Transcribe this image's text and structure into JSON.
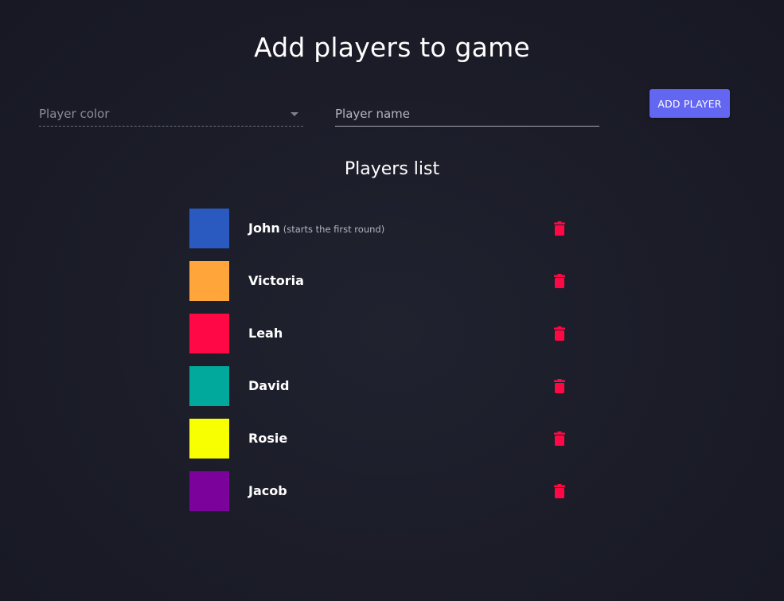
{
  "header": {
    "title": "Add players to game"
  },
  "form": {
    "color_label": "Player color",
    "name_label": "Player name",
    "add_button_label": "ADD PLAYER"
  },
  "players_section": {
    "title": "Players list",
    "players": [
      {
        "name": "John",
        "note": "(starts the first round)",
        "color": "#2a5ac0"
      },
      {
        "name": "Victoria",
        "note": "",
        "color": "#ffa53a"
      },
      {
        "name": "Leah",
        "note": "",
        "color": "#ff0845"
      },
      {
        "name": "David",
        "note": "",
        "color": "#00a99c"
      },
      {
        "name": "Rosie",
        "note": "",
        "color": "#f7ff00"
      },
      {
        "name": "Jacob",
        "note": "",
        "color": "#7b029b"
      }
    ]
  },
  "colors": {
    "accent": "#6366f1",
    "danger": "#ff0845"
  },
  "icons": {
    "delete": "trash-icon",
    "dropdown": "chevron-down-icon"
  }
}
